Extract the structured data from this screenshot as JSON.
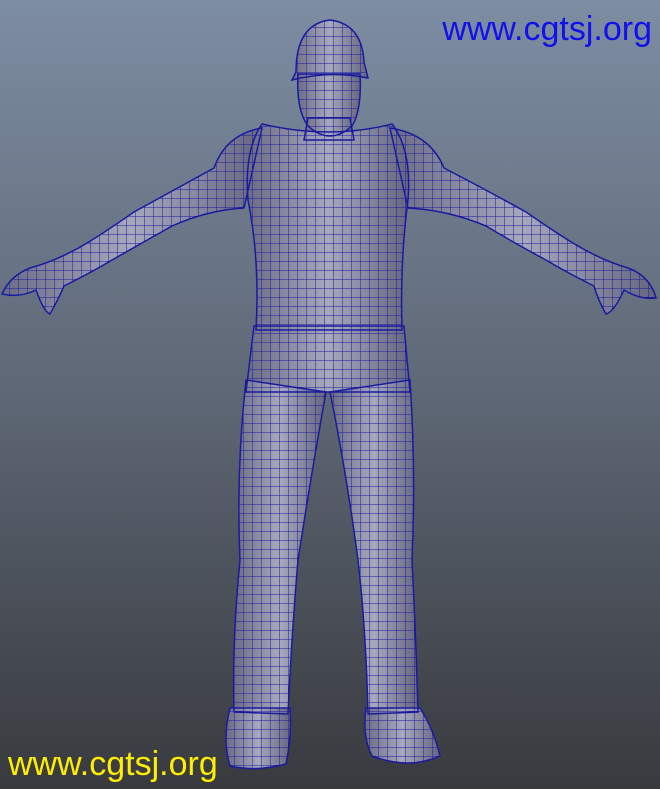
{
  "watermarks": {
    "top_right": {
      "text": "www.cgtsj.org",
      "color": "#1010ee"
    },
    "bottom_left": {
      "text": "www.cgtsj.org",
      "color": "#ffee00"
    }
  },
  "scene": {
    "subject": "wireframe-character-model",
    "background_top": "#7d8da2",
    "background_bottom": "#383a3e",
    "mesh_color": "#1a1aa0",
    "surface_color": "#8e8fa6"
  }
}
